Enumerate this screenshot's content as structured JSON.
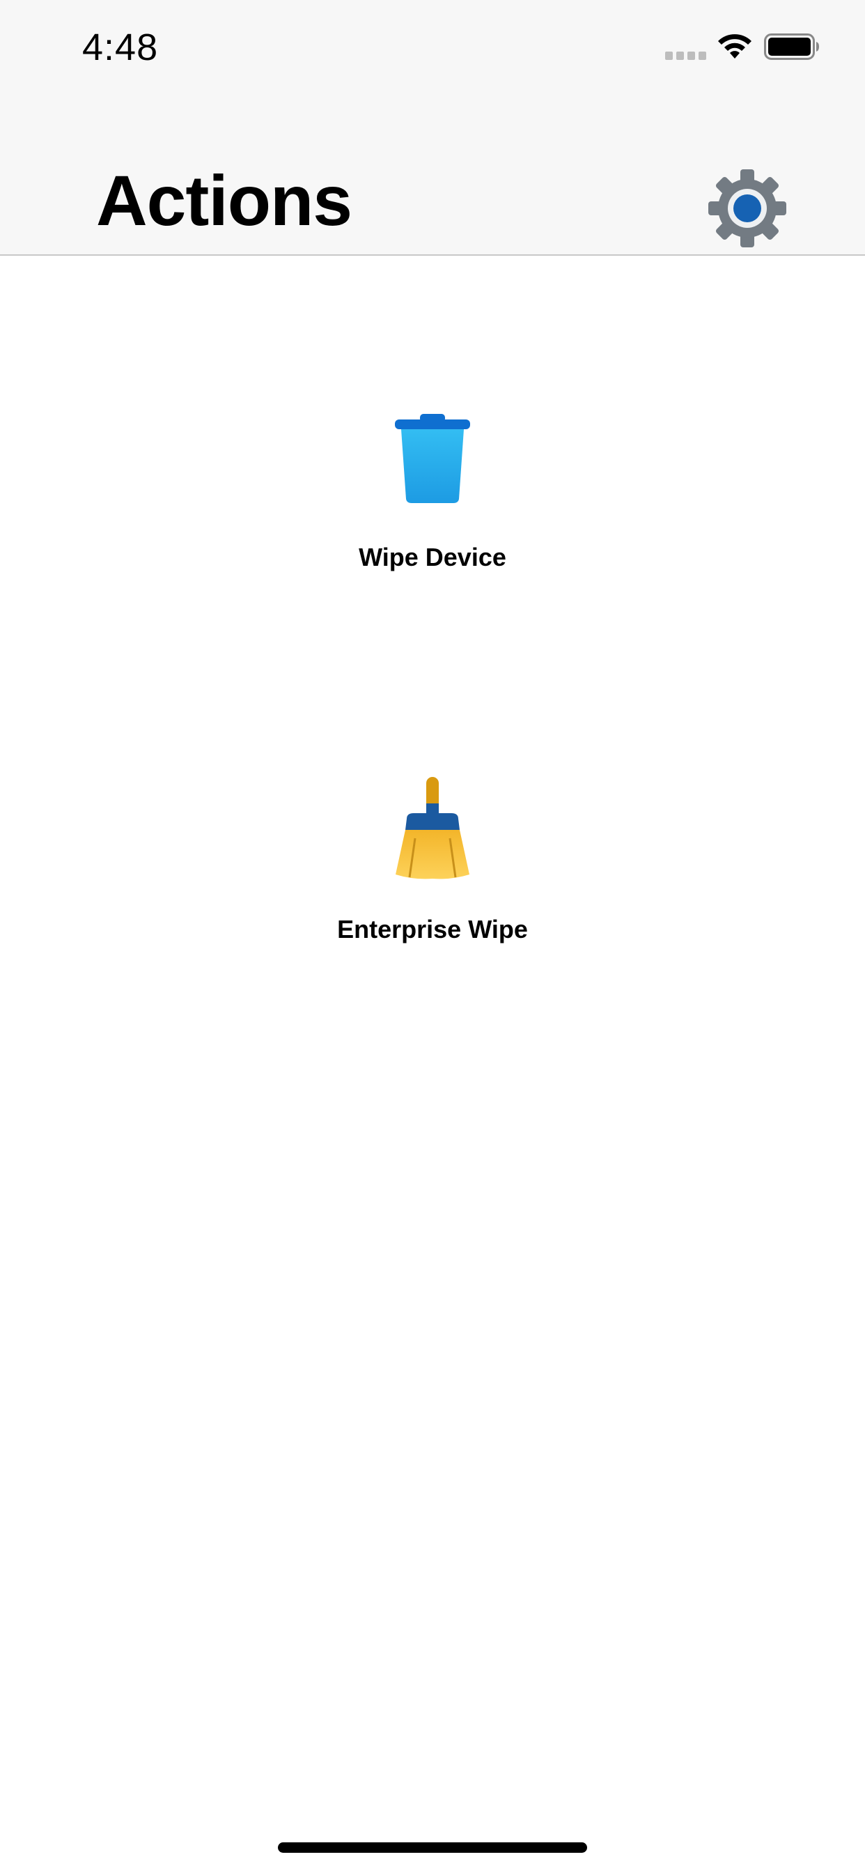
{
  "status_bar": {
    "time": "4:48",
    "signal_icon": "cellular-signal-icon",
    "wifi_icon": "wifi-icon",
    "battery_icon": "battery-icon"
  },
  "header": {
    "title": "Actions",
    "settings_icon": "gear-icon",
    "background_color": "#f7f7f7"
  },
  "actions": [
    {
      "label": "Wipe Device",
      "icon": "trash-can-icon",
      "color": "#29a8ec"
    },
    {
      "label": "Enterprise Wipe",
      "icon": "broom-icon",
      "color": "#fbc93d"
    }
  ],
  "colors": {
    "gear_body": "#737b83",
    "gear_center": "#1662b3",
    "broom_band": "#1b5aa0",
    "broom_handle": "#d99a10"
  }
}
